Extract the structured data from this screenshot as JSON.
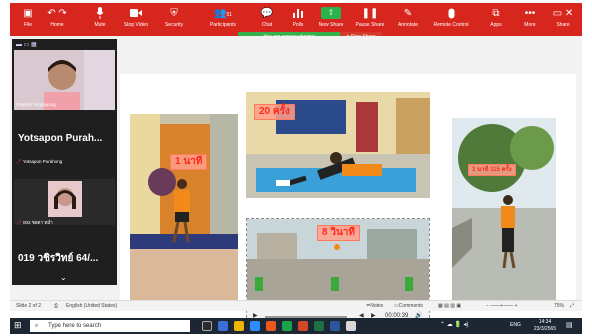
{
  "toolbar": {
    "file": "File",
    "home": "Home",
    "mute": "Mute",
    "stop_video": "Stop Video",
    "security": "Security",
    "participants": "Participants",
    "participants_count": "51",
    "chat": "Chat",
    "polls": "Polls",
    "new_share": "New Share",
    "pause_share": "Pause Share",
    "annotate": "Annotate",
    "remote_control": "Remote Control",
    "apps": "Apps",
    "more": "More",
    "share": "Share"
  },
  "banner": {
    "sharing_text": "You are screen sharing",
    "stop_share": "Stop Share"
  },
  "panel": {
    "tile1_name": "Oraphin Wiriyapong",
    "big_name_1": "Yotsapon Purah...",
    "tile2_name": "Yotsapon Purahong",
    "tile3_name": "003 ชลดา หม่ำ",
    "big_name_2": "019 วชิรวิทย์ 64/...",
    "collapse": "⌄"
  },
  "slide": {
    "label_1": "1 นาที",
    "label_2": "20 ครั้ง",
    "label_3": "8 วินาที",
    "label_4": "1 นาที 115 ครั้ง",
    "video_time": "00:00:39"
  },
  "status": {
    "slide_info": "Slide 2 of 2",
    "language": "English (United States)",
    "notes": "Notes",
    "comments": "Comments",
    "zoom": "75%"
  },
  "taskbar": {
    "search_placeholder": "Type here to search",
    "lang": "ENG",
    "time": "14:34",
    "date": "23/3/2565"
  },
  "colors": {
    "zoom_red": "#d7261e",
    "banner_green": "#36b04b",
    "stop_red": "#d23a2a",
    "label_text": "#ff2a1a"
  }
}
